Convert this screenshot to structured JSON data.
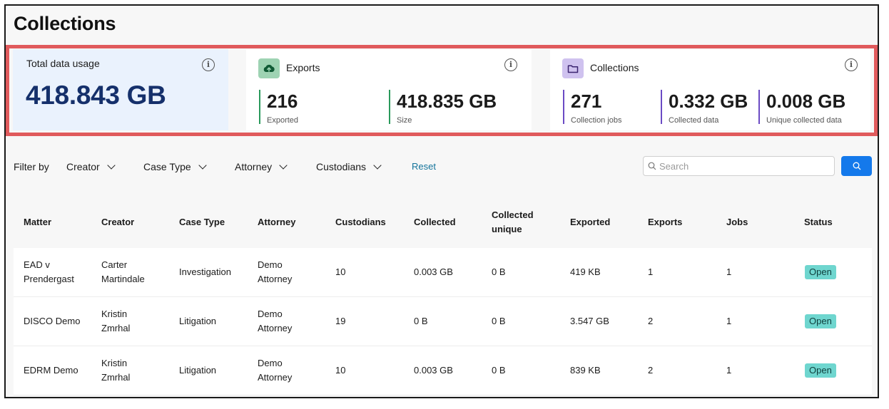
{
  "page": {
    "title": "Collections"
  },
  "cards": {
    "usage": {
      "label": "Total data usage",
      "value": "418.843 GB"
    },
    "exports": {
      "title": "Exports",
      "stats": [
        {
          "value": "216",
          "label": "Exported"
        },
        {
          "value": "418.835 GB",
          "label": "Size"
        }
      ]
    },
    "collections": {
      "title": "Collections",
      "stats": [
        {
          "value": "271",
          "label": "Collection jobs"
        },
        {
          "value": "0.332 GB",
          "label": "Collected data"
        },
        {
          "value": "0.008 GB",
          "label": "Unique collected data"
        }
      ]
    },
    "info_icon": "i"
  },
  "filters": {
    "label": "Filter by",
    "dropdowns": [
      "Creator",
      "Case Type",
      "Attorney",
      "Custodians"
    ],
    "reset": "Reset",
    "search_placeholder": "Search"
  },
  "table": {
    "headers": [
      [
        "Matter"
      ],
      [
        "Creator"
      ],
      [
        "Case Type"
      ],
      [
        "Attorney"
      ],
      [
        "Custodians"
      ],
      [
        "Collected"
      ],
      [
        "Collected",
        "unique"
      ],
      [
        "Exported"
      ],
      [
        "Exports"
      ],
      [
        "Jobs"
      ],
      [
        "Status"
      ]
    ],
    "rows": [
      {
        "matter": [
          "EAD v",
          "Prendergast"
        ],
        "creator": [
          "Carter",
          "Martindale"
        ],
        "case_type": "Investigation",
        "attorney": [
          "Demo",
          "Attorney"
        ],
        "custodians": "10",
        "collected": "0.003 GB",
        "collected_unique": "0 B",
        "exported": "419 KB",
        "exports": "1",
        "jobs": "1",
        "status": "Open"
      },
      {
        "matter": [
          "DISCO Demo"
        ],
        "creator": [
          "Kristin",
          "Zmrhal"
        ],
        "case_type": "Litigation",
        "attorney": [
          "Demo",
          "Attorney"
        ],
        "custodians": "19",
        "collected": "0 B",
        "collected_unique": "0 B",
        "exported": "3.547 GB",
        "exports": "2",
        "jobs": "1",
        "status": "Open"
      },
      {
        "matter": [
          "EDRM Demo"
        ],
        "creator": [
          "Kristin",
          "Zmrhal"
        ],
        "case_type": "Litigation",
        "attorney": [
          "Demo",
          "Attorney"
        ],
        "custodians": "10",
        "collected": "0.003 GB",
        "collected_unique": "0 B",
        "exported": "839 KB",
        "exports": "2",
        "jobs": "1",
        "status": "Open"
      }
    ]
  },
  "colors": {
    "highlight": "#e05a5c",
    "usage_value": "#15306b",
    "exports_accent": "#2a9a5c",
    "collections_accent": "#6b4bc4",
    "status_badge": "#6fd6cf",
    "search_button": "#1479eb",
    "reset_link": "#14749b"
  },
  "icons": {
    "exports": "cloud-upload-icon",
    "collections": "folder-icon",
    "info": "info-icon",
    "search": "search-icon",
    "dropdown": "chevron-down-icon"
  }
}
